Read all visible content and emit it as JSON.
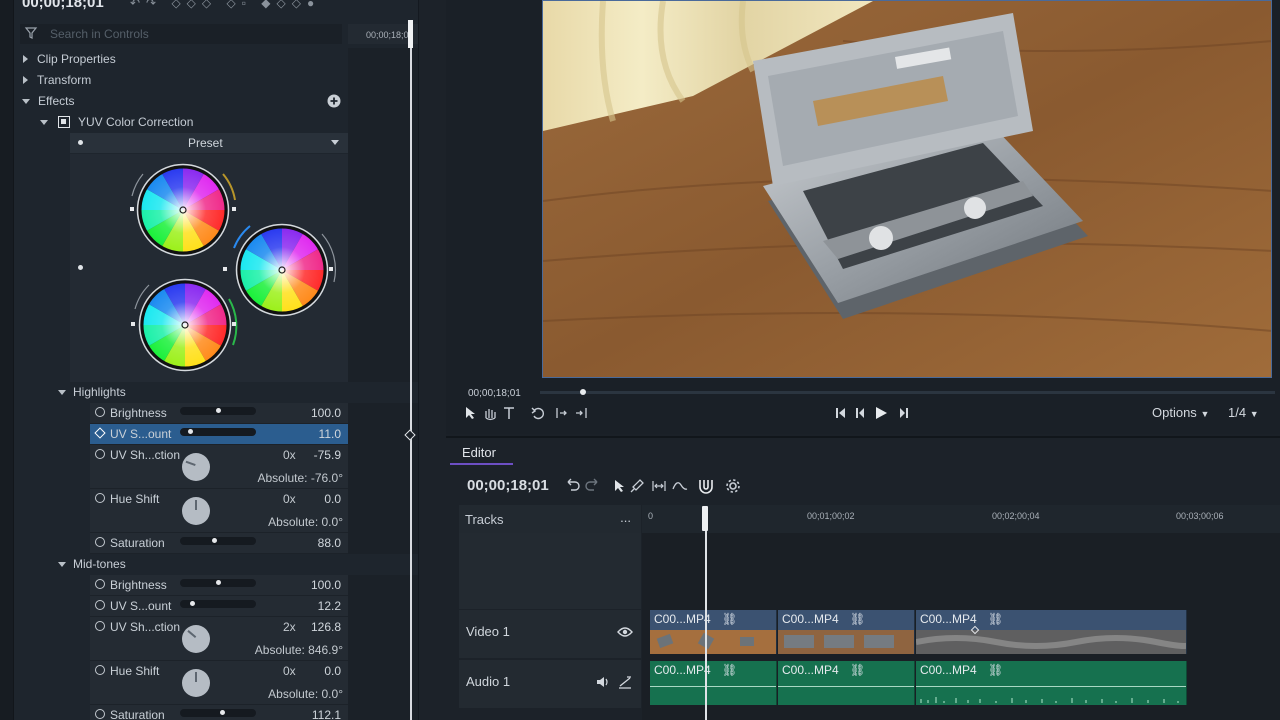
{
  "top": {
    "timecode": "00;00;18;01"
  },
  "search": {
    "placeholder": "Search in Controls"
  },
  "controls_ruler": {
    "timecode": "00;00;18;0"
  },
  "tree": {
    "clip_properties": "Clip Properties",
    "transform": "Transform",
    "effects": "Effects",
    "yuv": "YUV Color Correction",
    "preset": "Preset"
  },
  "highlights": {
    "title": "Highlights",
    "brightness": {
      "label": "Brightness",
      "value": "100.0",
      "level": 0.5
    },
    "uv_amount": {
      "label": "UV S...ount",
      "value": "11.0",
      "level": 0.11
    },
    "uv_direction": {
      "label": "UV Sh...ction",
      "mult": "0x",
      "value": "-75.9",
      "absolute": "Absolute: -76.0°"
    },
    "hue_shift": {
      "label": "Hue Shift",
      "mult": "0x",
      "value": "0.0",
      "absolute": "Absolute: 0.0°"
    },
    "saturation": {
      "label": "Saturation",
      "value": "88.0",
      "level": 0.44
    }
  },
  "midtones": {
    "title": "Mid-tones",
    "brightness": {
      "label": "Brightness",
      "value": "100.0",
      "level": 0.5
    },
    "uv_amount": {
      "label": "UV S...ount",
      "value": "12.2",
      "level": 0.12
    },
    "uv_direction": {
      "label": "UV Sh...ction",
      "mult": "2x",
      "value": "126.8",
      "absolute": "Absolute: 846.9°"
    },
    "hue_shift": {
      "label": "Hue Shift",
      "mult": "0x",
      "value": "0.0",
      "absolute": "Absolute: 0.0°"
    },
    "saturation": {
      "label": "Saturation",
      "value": "112.1",
      "level": 0.56
    }
  },
  "viewer": {
    "timecode": "00;00;18;01",
    "options": "Options",
    "ratio": "1/4"
  },
  "editor": {
    "tab": "Editor",
    "timecode": "00;00;18;01",
    "tracks_label": "Tracks",
    "tracks_menu": "...",
    "ruler": [
      "0",
      "00;01;00;02",
      "00;02;00;04",
      "00;03;00;06"
    ],
    "video_track": "Video 1",
    "audio_track": "Audio 1",
    "video_clips": [
      "C00...MP4",
      "C00...MP4",
      "C00...MP4"
    ],
    "audio_clips": [
      "C00...MP4",
      "C00...MP4",
      "C00...MP4"
    ]
  },
  "colors": {
    "accent": "#6d4fc4",
    "selection": "#2b5d8f",
    "video_clip": "#3b5271",
    "audio_clip": "#16714f"
  }
}
